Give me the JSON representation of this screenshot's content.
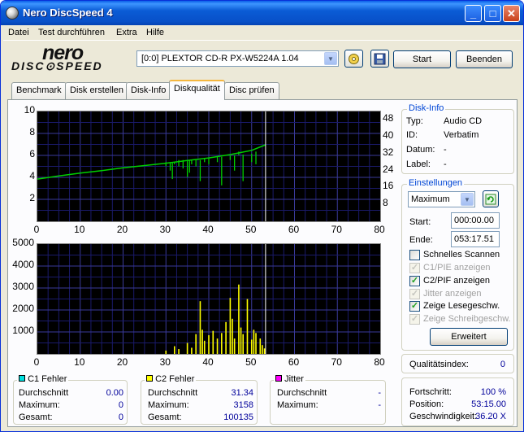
{
  "window": {
    "title": "Nero DiscSpeed 4",
    "minimize": "_",
    "maximize": "□",
    "close": "✕"
  },
  "menu": [
    "Datei",
    "Test durchführen",
    "Extra",
    "Hilfe"
  ],
  "logo": {
    "line1": "nero",
    "line2": "DISC⊙SPEED"
  },
  "drive": {
    "selected": "[0:0]  PLEXTOR CD-R   PX-W5224A 1.04"
  },
  "toolbar": {
    "start_label": "Start",
    "exit_label": "Beenden",
    "eject_icon": "eject-icon",
    "save_icon": "save-icon"
  },
  "tabs": [
    {
      "label": "Benchmark",
      "active": false
    },
    {
      "label": "Disk erstellen",
      "active": false
    },
    {
      "label": "Disk-Info",
      "active": false
    },
    {
      "label": "Diskqualität",
      "active": true
    },
    {
      "label": "Disc prüfen",
      "active": false
    }
  ],
  "disk_info": {
    "title": "Disk-Info",
    "rows": [
      {
        "label": "Typ:",
        "value": "Audio CD"
      },
      {
        "label": "ID:",
        "value": "Verbatim"
      },
      {
        "label": "Datum:",
        "value": "-"
      },
      {
        "label": "Label:",
        "value": "-"
      }
    ]
  },
  "settings": {
    "title": "Einstellungen",
    "speed": "Maximum",
    "start_label": "Start:",
    "start_value": "000:00.00",
    "end_label": "Ende:",
    "end_value": "053:17.51",
    "checkboxes": [
      {
        "label": "Schnelles Scannen",
        "checked": false,
        "disabled": false
      },
      {
        "label": "C1/PIE anzeigen",
        "checked": true,
        "disabled": true
      },
      {
        "label": "C2/PIF anzeigen",
        "checked": true,
        "disabled": false
      },
      {
        "label": "Jitter anzeigen",
        "checked": true,
        "disabled": true
      },
      {
        "label": "Zeige Lesegeschw.",
        "checked": true,
        "disabled": false
      },
      {
        "label": "Zeige Schreibgeschw.",
        "checked": true,
        "disabled": true
      }
    ],
    "advanced_label": "Erweitert"
  },
  "quality": {
    "label": "Qualitätsindex:",
    "value": "0"
  },
  "progress": {
    "rows": [
      {
        "label": "Fortschritt:",
        "value": "100 %"
      },
      {
        "label": "Position:",
        "value": "53:15.00"
      },
      {
        "label": "Geschwindigkeit:",
        "value": "36.20 X"
      }
    ]
  },
  "stats": {
    "c1": {
      "title": "C1 Fehler",
      "color": "#00e0e0",
      "avg_label": "Durchschnitt",
      "avg": "0.00",
      "max_label": "Maximum:",
      "max": "0",
      "total_label": "Gesamt:",
      "total": "0"
    },
    "c2": {
      "title": "C2 Fehler",
      "color": "#ffff00",
      "avg_label": "Durchschnitt",
      "avg": "31.34",
      "max_label": "Maximum:",
      "max": "3158",
      "total_label": "Gesamt:",
      "total": "100135"
    },
    "jitter": {
      "title": "Jitter",
      "color": "#ff00ff",
      "avg_label": "Durchschnitt",
      "avg": "-",
      "max_label": "Maximum:",
      "max": "-"
    }
  },
  "chart_data": [
    {
      "type": "line",
      "series_color": "#00d000",
      "x_ticks": [
        "0",
        "10",
        "20",
        "30",
        "40",
        "50",
        "60",
        "70",
        "80"
      ],
      "y_ticks_left": [
        "10",
        "8",
        "6",
        "4",
        "2"
      ],
      "y_ticks_right": [
        "48",
        "40",
        "32",
        "24",
        "16",
        "8"
      ],
      "xlim": [
        0,
        80
      ],
      "ylim_left": [
        0,
        10
      ],
      "ylim_right": [
        0,
        52
      ],
      "speed_x": [
        0,
        5,
        10,
        15,
        20,
        25,
        30,
        35,
        40,
        45,
        50,
        53.25
      ],
      "speed_y": [
        20.0,
        21.5,
        22.8,
        24.0,
        25.3,
        26.4,
        27.5,
        28.8,
        30.0,
        31.6,
        33.6,
        36.2
      ],
      "dips": [
        [
          30,
          28,
          26
        ],
        [
          31,
          28,
          24
        ],
        [
          31.5,
          28,
          20
        ],
        [
          32,
          28,
          27
        ],
        [
          33,
          29,
          26
        ],
        [
          34,
          29,
          25
        ],
        [
          35,
          29,
          21
        ],
        [
          35.5,
          29,
          23
        ],
        [
          36,
          29,
          27
        ],
        [
          37,
          29,
          26
        ],
        [
          38,
          29,
          19
        ],
        [
          39,
          29.5,
          28
        ],
        [
          40,
          30,
          27
        ],
        [
          42,
          30.5,
          28
        ],
        [
          43,
          30.5,
          17
        ],
        [
          45,
          31,
          29
        ],
        [
          46,
          31.2,
          24
        ],
        [
          47,
          31.4,
          33
        ],
        [
          48,
          31.6,
          19
        ],
        [
          50,
          32,
          28
        ],
        [
          51,
          33,
          27
        ]
      ],
      "marker_x": 53.25
    },
    {
      "type": "bar",
      "series_color": "#ffff00",
      "x_ticks": [
        "0",
        "10",
        "20",
        "30",
        "40",
        "50",
        "60",
        "70",
        "80"
      ],
      "y_ticks": [
        "5000",
        "4000",
        "3000",
        "2000",
        "1000"
      ],
      "xlim": [
        0,
        80
      ],
      "ylim": [
        0,
        5000
      ],
      "peaks": [
        [
          30,
          150
        ],
        [
          32,
          350
        ],
        [
          33,
          220
        ],
        [
          35,
          500
        ],
        [
          36,
          280
        ],
        [
          37,
          900
        ],
        [
          38,
          2400
        ],
        [
          38.5,
          1100
        ],
        [
          39,
          600
        ],
        [
          40,
          850
        ],
        [
          41,
          1050
        ],
        [
          42,
          700
        ],
        [
          43,
          950
        ],
        [
          44,
          1450
        ],
        [
          45,
          2550
        ],
        [
          45.5,
          1600
        ],
        [
          46,
          700
        ],
        [
          47,
          3158
        ],
        [
          47.5,
          1200
        ],
        [
          48,
          900
        ],
        [
          49,
          2500
        ],
        [
          50,
          650
        ],
        [
          50.5,
          1100
        ],
        [
          51,
          950
        ],
        [
          52,
          700
        ],
        [
          52.5,
          400
        ],
        [
          53,
          250
        ]
      ],
      "marker_x": 53.25
    }
  ]
}
